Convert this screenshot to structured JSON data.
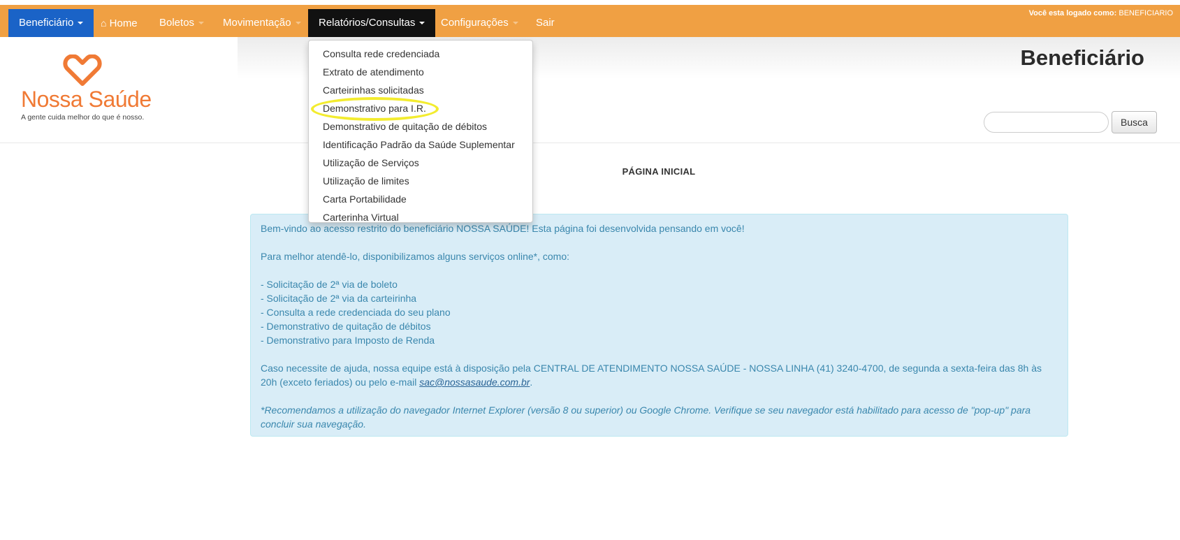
{
  "navbar": {
    "brand_label": "Beneficiário",
    "home_label": "Home",
    "boletos_label": "Boletos",
    "movimentacao_label": "Movimentação",
    "relatorios_label": "Relatórios/Consultas",
    "configuracoes_label": "Configurações",
    "sair_label": "Sair",
    "logged_prefix": "Você esta logado como:",
    "logged_user": "BENEFICIARIO"
  },
  "logo": {
    "name": "Nossa Saúde",
    "tagline": "A gente cuida melhor do que é nosso."
  },
  "header": {
    "title": "Beneficiário",
    "search_button": "Busca",
    "search_placeholder": ""
  },
  "main": {
    "section_title": "PÁGINA INICIAL",
    "welcome": "Bem-vindo ao acesso restrito do beneficiário NOSSA SAÚDE! Esta página foi desenvolvida pensando em você!",
    "intro": "Para melhor atendê-lo, disponibilizamos alguns serviços online*, como:",
    "services": [
      "- Solicitação de 2ª via de boleto",
      "- Solicitação de 2ª via da carteirinha",
      "- Consulta a rede credenciada do seu plano",
      "- Demonstrativo de quitação de débitos",
      "- Demonstrativo para Imposto de Renda"
    ],
    "help_text": "Caso necessite de ajuda, nossa equipe está à disposição pela CENTRAL DE ATENDIMENTO NOSSA SAÚDE - NOSSA LINHA (41) 3240-4700, de segunda a sexta-feira das 8h às 20h (exceto feriados) ou pelo e-mail",
    "help_email": "sac@nossasaude.com.br",
    "help_end": ".",
    "note": "*Recomendamos a utilização do navegador Internet Explorer (versão 8 ou superior) ou Google Chrome. Verifique se seu navegador está habilitado para acesso de \"pop-up\" para concluir sua navegação."
  },
  "dropdown": {
    "items": [
      "Consulta rede credenciada",
      "Extrato de atendimento",
      "Carteirinhas solicitadas",
      "Demonstrativo para I.R.",
      "Demonstrativo de quitação de débitos",
      "Identificação Padrão da Saúde Suplementar",
      "Utilização de Serviços",
      "Utilização de limites",
      "Carta Portabilidade",
      "Carterinha Virtual"
    ],
    "highlighted_index": 3
  },
  "colors": {
    "navbar": "#f0a043",
    "brand": "#1a63c7",
    "active_menu": "#111111",
    "logo_orange": "#f07a35",
    "info_bg": "#d9edf7",
    "info_text": "#3a87ad",
    "highlight": "#f3ec2f"
  }
}
